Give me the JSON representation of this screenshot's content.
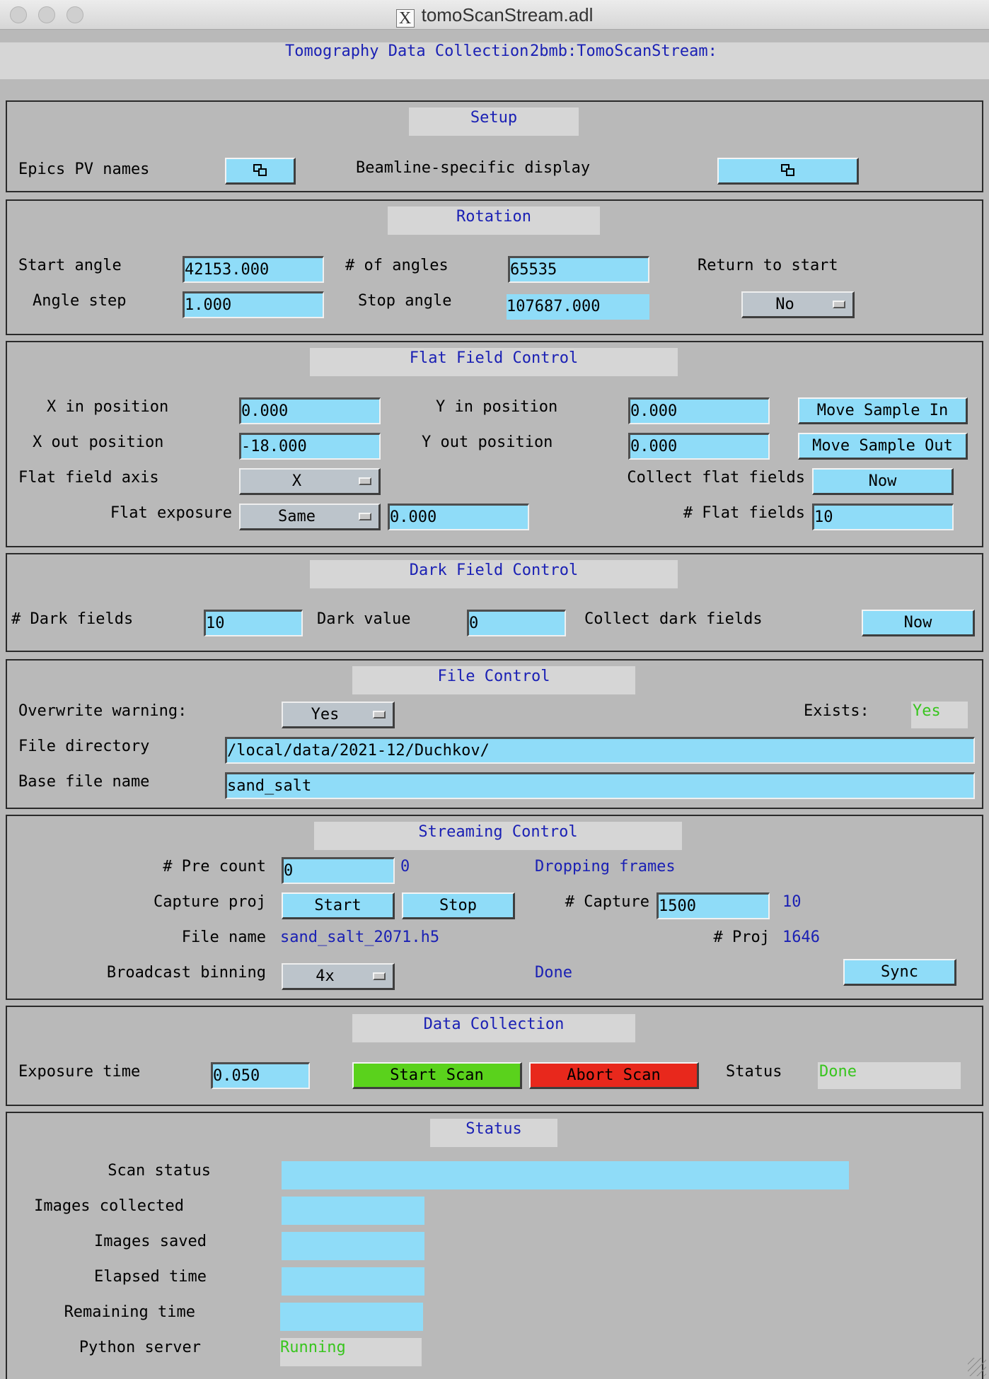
{
  "window": {
    "title": "tomoScanStream.adl",
    "x_glyph": "X"
  },
  "header": {
    "title": "Tomography Data Collection",
    "prefix": "2bmb:TomoScanStream:"
  },
  "setup": {
    "title": "Setup",
    "epics_label": "Epics PV names",
    "beamline_label": "Beamline-specific display"
  },
  "rotation": {
    "title": "Rotation",
    "start_angle_label": "Start angle",
    "start_angle": "42153.000",
    "num_angles_label": "# of angles",
    "num_angles": "65535",
    "return_label": "Return to start",
    "angle_step_label": "Angle step",
    "angle_step": "1.000",
    "stop_angle_label": "Stop angle",
    "stop_angle": "107687.000",
    "return_value": "No"
  },
  "flat": {
    "title": "Flat Field Control",
    "x_in_label": "X in position",
    "x_in": "0.000",
    "y_in_label": "Y in position",
    "y_in": "0.000",
    "move_in": "Move Sample In",
    "x_out_label": "X out position",
    "x_out": "-18.000",
    "y_out_label": "Y out position",
    "y_out": "0.000",
    "move_out": "Move Sample Out",
    "axis_label": "Flat field axis",
    "axis_value": "X",
    "collect_label": "Collect flat fields",
    "collect_btn": "Now",
    "exposure_label": "Flat exposure",
    "exposure_mode": "Same",
    "exposure_value": "0.000",
    "num_flat_label": "# Flat fields",
    "num_flat": "10"
  },
  "dark": {
    "title": "Dark Field Control",
    "num_label": "# Dark fields",
    "num": "10",
    "value_label": "Dark value",
    "value": "0",
    "collect_label": "Collect dark fields",
    "collect_btn": "Now"
  },
  "file": {
    "title": "File Control",
    "overwrite_label": "Overwrite warning:",
    "overwrite_value": "Yes",
    "exists_label": "Exists:",
    "exists_value": "Yes",
    "dir_label": "File directory",
    "dir": "/local/data/2021-12/Duchkov/",
    "base_label": "Base file name",
    "base": "sand_salt"
  },
  "stream": {
    "title": "Streaming Control",
    "precount_label": "# Pre count",
    "precount": "0",
    "precount_rb": "0",
    "dropping": "Dropping frames",
    "capture_label": "Capture proj",
    "start_btn": "Start",
    "stop_btn": "Stop",
    "num_capture_label": "# Capture",
    "num_capture": "1500",
    "num_capture_rb": "10",
    "filename_label": "File name",
    "filename": "sand_salt_2071.h5",
    "proj_label": "# Proj",
    "proj": "1646",
    "binning_label": "Broadcast binning",
    "binning": "4x",
    "binning_status": "Done",
    "sync_btn": "Sync"
  },
  "collect": {
    "title": "Data Collection",
    "exposure_label": "Exposure time",
    "exposure": "0.050",
    "start_btn": "Start Scan",
    "abort_btn": "Abort Scan",
    "status_label": "Status",
    "status": "Done",
    "colors": {
      "start": "#5ad21c",
      "abort": "#e8281c"
    }
  },
  "status": {
    "title": "Status",
    "scan_label": "Scan status",
    "images_collected_label": "Images collected",
    "images_saved_label": "Images saved",
    "elapsed_label": "Elapsed time",
    "remaining_label": "Remaining time",
    "python_label": "Python server",
    "python_value": "Running"
  },
  "colors": {
    "pv_blue": "#1a20b4",
    "field": "#8fdcf8",
    "ok_green": "#38c51e"
  }
}
